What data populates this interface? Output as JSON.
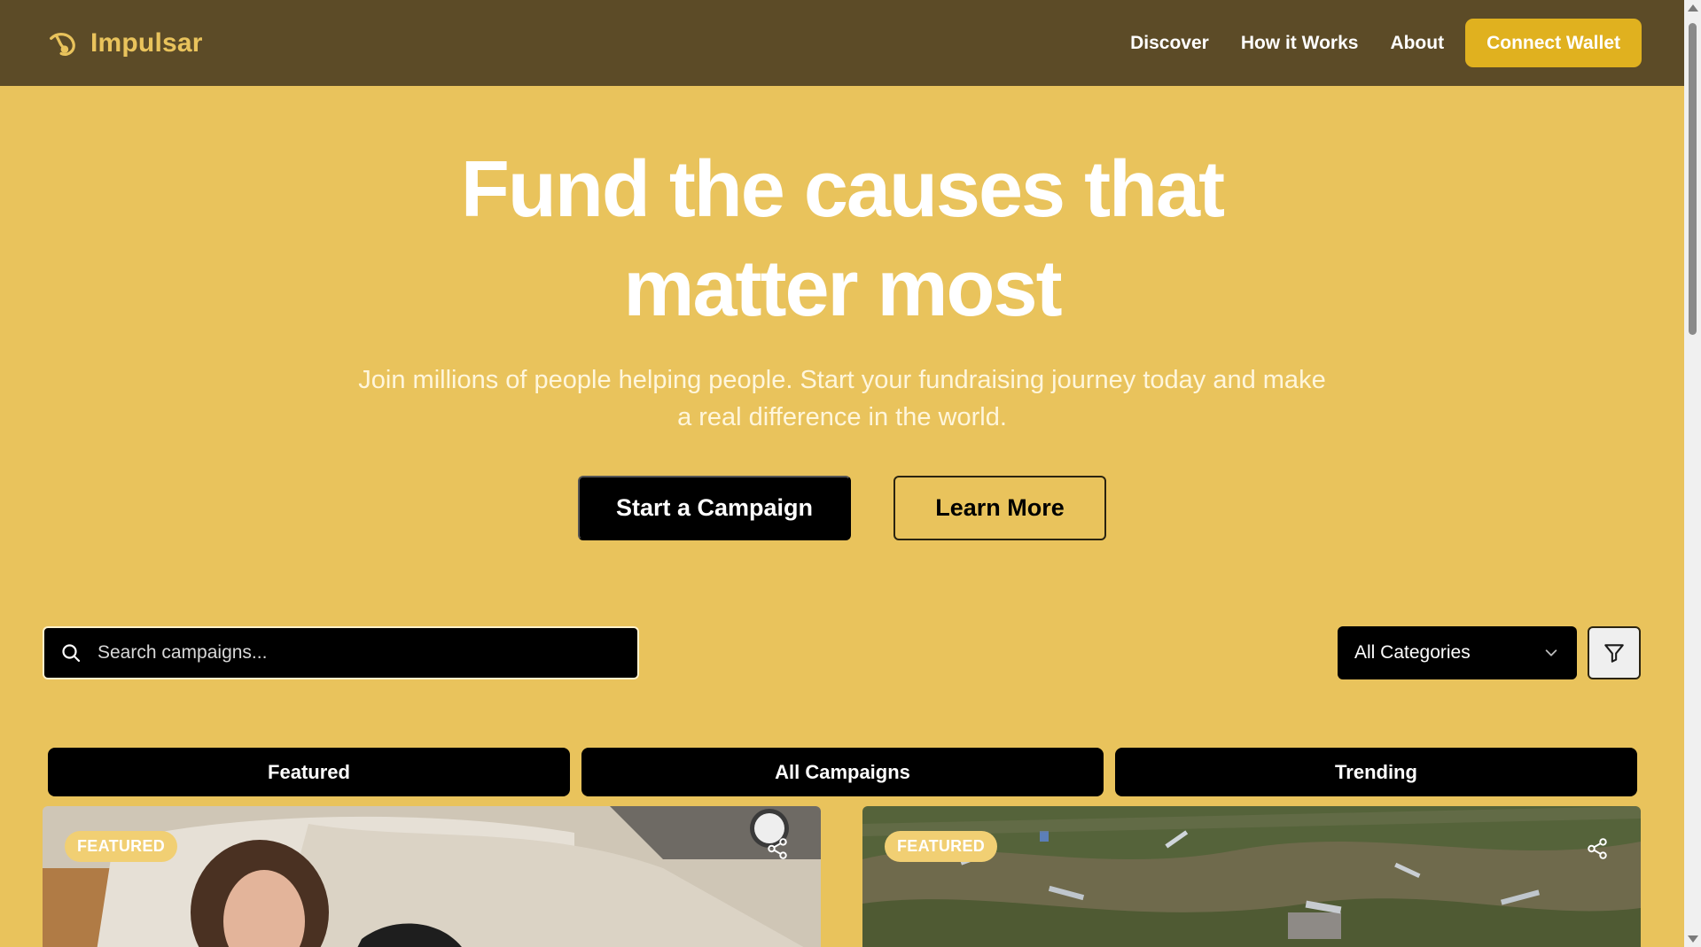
{
  "brand": {
    "name": "Impulsar",
    "logo_icon": "comet-icon",
    "color": "#E9C35C"
  },
  "nav": {
    "links": [
      "Discover",
      "How it Works",
      "About"
    ],
    "connect_label": "Connect Wallet",
    "background": "#5C4B27",
    "accent": "#E0B11F"
  },
  "hero": {
    "title_line1": "Fund the causes that",
    "title_line2": "matter most",
    "subtitle_line1": "Join millions of people helping people. Start your fundraising journey today and make",
    "subtitle_line2": "a real difference in the world.",
    "primary_cta": "Start a Campaign",
    "secondary_cta": "Learn More",
    "background": "#E9C35C"
  },
  "search": {
    "placeholder": "Search campaigns...",
    "value": "",
    "icon": "search-icon"
  },
  "category_filter": {
    "selected": "All Categories",
    "icon": "chevron-down-icon"
  },
  "filter_button": {
    "icon": "filter-icon"
  },
  "tabs": [
    "Featured",
    "All Campaigns",
    "Trending"
  ],
  "cards": [
    {
      "badge": "FEATURED",
      "share_icon": "share-icon",
      "image": "person-in-bed"
    },
    {
      "badge": "FEATURED",
      "share_icon": "share-icon",
      "image": "aerial-debris-field"
    }
  ]
}
